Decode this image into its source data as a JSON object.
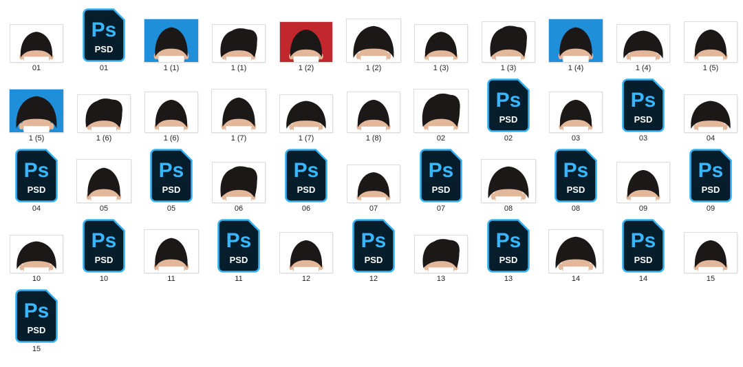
{
  "colors": {
    "photo_white": "#ffffff",
    "photo_blue": "#1e8fd8",
    "photo_red": "#c0282d",
    "hair": "#1b1817",
    "skin": "#e3b89a",
    "psd_bg": "#061e2c",
    "psd_border": "#32b2f2",
    "psd_text": "#38b6ff",
    "psd_sub": "#ffffff"
  },
  "psd_badge": {
    "main": "Ps",
    "sub": "PSD"
  },
  "files": [
    {
      "label": "01",
      "kind": "photo",
      "bg": "white",
      "shape": "a"
    },
    {
      "label": "01",
      "kind": "psd"
    },
    {
      "label": "1 (1)",
      "kind": "photo",
      "bg": "blue",
      "shape": "a"
    },
    {
      "label": "1 (1)",
      "kind": "photo",
      "bg": "white",
      "shape": "b"
    },
    {
      "label": "1 (2)",
      "kind": "photo",
      "bg": "red",
      "shape": "a"
    },
    {
      "label": "1 (2)",
      "kind": "photo",
      "bg": "white",
      "shape": "c"
    },
    {
      "label": "1 (3)",
      "kind": "photo",
      "bg": "white",
      "shape": "a"
    },
    {
      "label": "1 (3)",
      "kind": "photo",
      "bg": "white",
      "shape": "b"
    },
    {
      "label": "1 (4)",
      "kind": "photo",
      "bg": "blue",
      "shape": "a"
    },
    {
      "label": "1 (4)",
      "kind": "photo",
      "bg": "white",
      "shape": "c"
    },
    {
      "label": "1 (5)",
      "kind": "photo",
      "bg": "white",
      "shape": "a"
    },
    {
      "label": "1 (5)",
      "kind": "photo",
      "bg": "blue",
      "shape": "c"
    },
    {
      "label": "1 (6)",
      "kind": "photo",
      "bg": "white",
      "shape": "b"
    },
    {
      "label": "1 (6)",
      "kind": "photo",
      "bg": "white",
      "shape": "a"
    },
    {
      "label": "1 (7)",
      "kind": "photo",
      "bg": "white",
      "shape": "a"
    },
    {
      "label": "1 (7)",
      "kind": "photo",
      "bg": "white",
      "shape": "c"
    },
    {
      "label": "1 (8)",
      "kind": "photo",
      "bg": "white",
      "shape": "a"
    },
    {
      "label": "02",
      "kind": "photo",
      "bg": "white",
      "shape": "b"
    },
    {
      "label": "02",
      "kind": "psd"
    },
    {
      "label": "03",
      "kind": "photo",
      "bg": "white",
      "shape": "a"
    },
    {
      "label": "03",
      "kind": "psd"
    },
    {
      "label": "04",
      "kind": "photo",
      "bg": "white",
      "shape": "c"
    },
    {
      "label": "04",
      "kind": "psd"
    },
    {
      "label": "05",
      "kind": "photo",
      "bg": "white",
      "shape": "a"
    },
    {
      "label": "05",
      "kind": "psd"
    },
    {
      "label": "06",
      "kind": "photo",
      "bg": "white",
      "shape": "b"
    },
    {
      "label": "06",
      "kind": "psd"
    },
    {
      "label": "07",
      "kind": "photo",
      "bg": "white",
      "shape": "a"
    },
    {
      "label": "07",
      "kind": "psd"
    },
    {
      "label": "08",
      "kind": "photo",
      "bg": "white",
      "shape": "c"
    },
    {
      "label": "08",
      "kind": "psd"
    },
    {
      "label": "09",
      "kind": "photo",
      "bg": "white",
      "shape": "a"
    },
    {
      "label": "09",
      "kind": "psd"
    },
    {
      "label": "10",
      "kind": "photo",
      "bg": "white",
      "shape": "c"
    },
    {
      "label": "10",
      "kind": "psd"
    },
    {
      "label": "11",
      "kind": "photo",
      "bg": "white",
      "shape": "a"
    },
    {
      "label": "11",
      "kind": "psd"
    },
    {
      "label": "12",
      "kind": "photo",
      "bg": "white",
      "shape": "a"
    },
    {
      "label": "12",
      "kind": "psd"
    },
    {
      "label": "13",
      "kind": "photo",
      "bg": "white",
      "shape": "b"
    },
    {
      "label": "13",
      "kind": "psd"
    },
    {
      "label": "14",
      "kind": "photo",
      "bg": "white",
      "shape": "c"
    },
    {
      "label": "14",
      "kind": "psd"
    },
    {
      "label": "15",
      "kind": "photo",
      "bg": "white",
      "shape": "a"
    },
    {
      "label": "15",
      "kind": "psd"
    }
  ]
}
